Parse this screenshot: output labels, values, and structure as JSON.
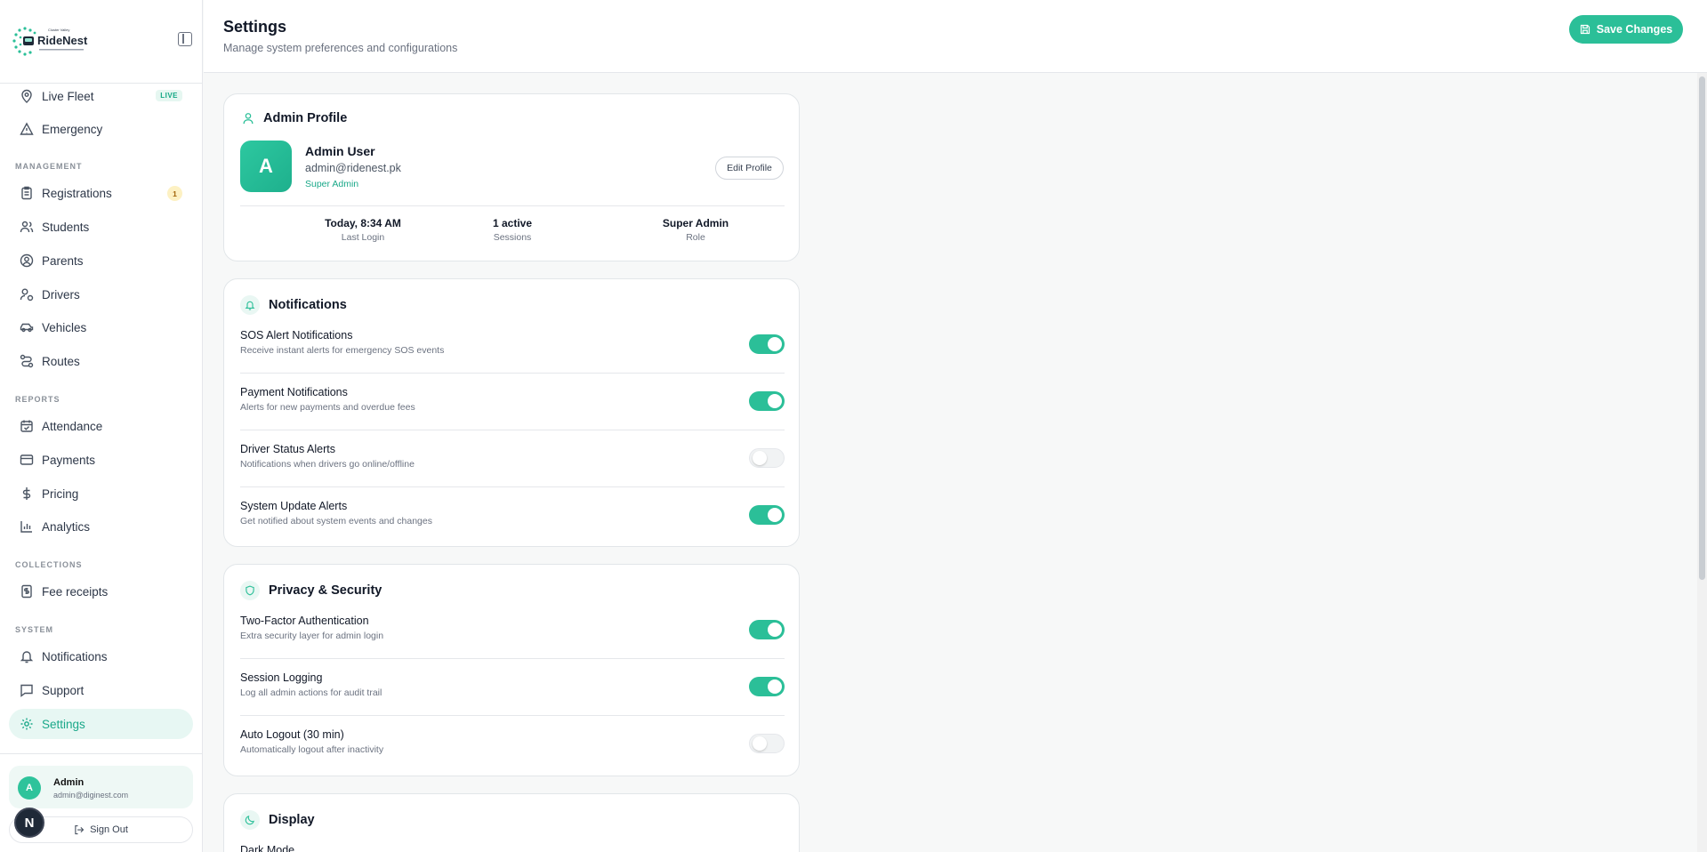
{
  "brand": {
    "name": "RideNest",
    "tagline": "Cluster Valley"
  },
  "sidebar": {
    "top_items": [
      {
        "label": "Live Fleet",
        "badge": "LIVE"
      },
      {
        "label": "Emergency"
      }
    ],
    "sections": [
      {
        "title": "MANAGEMENT",
        "items": [
          {
            "label": "Registrations",
            "badge": "1"
          },
          {
            "label": "Students"
          },
          {
            "label": "Parents"
          },
          {
            "label": "Drivers"
          },
          {
            "label": "Vehicles"
          },
          {
            "label": "Routes"
          }
        ]
      },
      {
        "title": "REPORTS",
        "items": [
          {
            "label": "Attendance"
          },
          {
            "label": "Payments"
          },
          {
            "label": "Pricing"
          },
          {
            "label": "Analytics"
          }
        ]
      },
      {
        "title": "COLLECTIONS",
        "items": [
          {
            "label": "Fee receipts"
          }
        ]
      },
      {
        "title": "SYSTEM",
        "items": [
          {
            "label": "Notifications"
          },
          {
            "label": "Support"
          },
          {
            "label": "Settings",
            "active": true
          }
        ]
      }
    ],
    "user": {
      "initial": "A",
      "name": "Admin",
      "email": "admin@diginest.com"
    },
    "sign_out": "Sign Out",
    "bubble": "N"
  },
  "header": {
    "title": "Settings",
    "subtitle": "Manage system preferences and configurations",
    "save_label": "Save Changes"
  },
  "profile": {
    "title": "Admin Profile",
    "initial": "A",
    "name": "Admin User",
    "email": "admin@ridenest.pk",
    "role": "Super Admin",
    "edit_label": "Edit Profile",
    "stats": [
      {
        "value": "Today, 8:34 AM",
        "label": "Last Login"
      },
      {
        "value": "1 active",
        "label": "Sessions"
      },
      {
        "value": "Super Admin",
        "label": "Role"
      }
    ]
  },
  "notifications": {
    "title": "Notifications",
    "items": [
      {
        "title": "SOS Alert Notifications",
        "desc": "Receive instant alerts for emergency SOS events",
        "on": true
      },
      {
        "title": "Payment Notifications",
        "desc": "Alerts for new payments and overdue fees",
        "on": true
      },
      {
        "title": "Driver Status Alerts",
        "desc": "Notifications when drivers go online/offline",
        "on": false
      },
      {
        "title": "System Update Alerts",
        "desc": "Get notified about system events and changes",
        "on": true
      }
    ]
  },
  "privacy": {
    "title": "Privacy & Security",
    "items": [
      {
        "title": "Two-Factor Authentication",
        "desc": "Extra security layer for admin login",
        "on": true
      },
      {
        "title": "Session Logging",
        "desc": "Log all admin actions for audit trail",
        "on": true
      },
      {
        "title": "Auto Logout (30 min)",
        "desc": "Automatically logout after inactivity",
        "on": false
      }
    ]
  },
  "display": {
    "title": "Display",
    "items": [
      {
        "title": "Dark Mode"
      }
    ]
  },
  "colors": {
    "accent": "#2bbf98",
    "accent_text": "#1aa889",
    "badge_yellow": "#fdf1c3"
  }
}
